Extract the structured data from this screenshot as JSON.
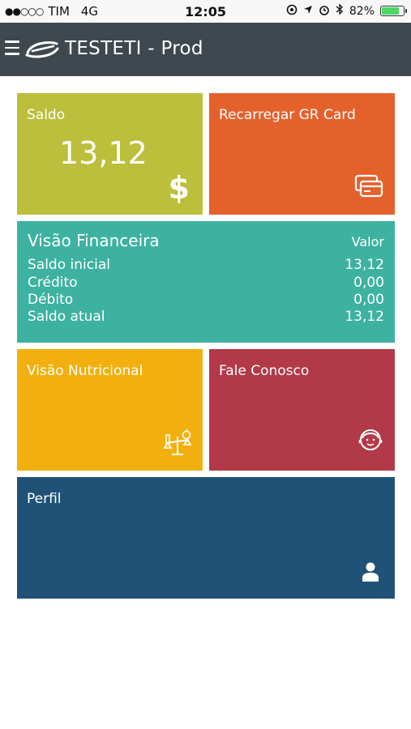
{
  "status_bar": {
    "signal": "●●○○○",
    "carrier": "TIM",
    "network": "4G",
    "time": "12:05",
    "battery_percent": "82%",
    "battery_level": 0.82
  },
  "app_bar": {
    "title": "TESTETI - Prod"
  },
  "tiles": {
    "saldo": {
      "label": "Saldo",
      "value": "13,12",
      "icon": "dollar-icon"
    },
    "recarregar": {
      "label": "Recarregar GR Card",
      "icon": "cards-icon"
    },
    "visao_financeira": {
      "title": "Visão Financeira",
      "column_header": "Valor",
      "rows": [
        {
          "label": "Saldo inicial",
          "value": "13,12"
        },
        {
          "label": "Crédito",
          "value": "0,00"
        },
        {
          "label": "Débito",
          "value": "0,00"
        },
        {
          "label": "Saldo atual",
          "value": "13,12"
        }
      ]
    },
    "visao_nutricional": {
      "label": "Visão Nutricional",
      "icon": "scale-apple-icon"
    },
    "fale_conosco": {
      "label": "Fale Conosco",
      "icon": "support-agent-icon"
    },
    "perfil": {
      "label": "Perfil",
      "icon": "user-icon"
    }
  },
  "colors": {
    "saldo": "#bcbf3b",
    "recarregar": "#e5612c",
    "visao_financeira": "#3db2a0",
    "visao_nutricional": "#f1b00f",
    "fale_conosco": "#b23a48",
    "perfil": "#1f5276",
    "app_bar": "#3f484f"
  }
}
